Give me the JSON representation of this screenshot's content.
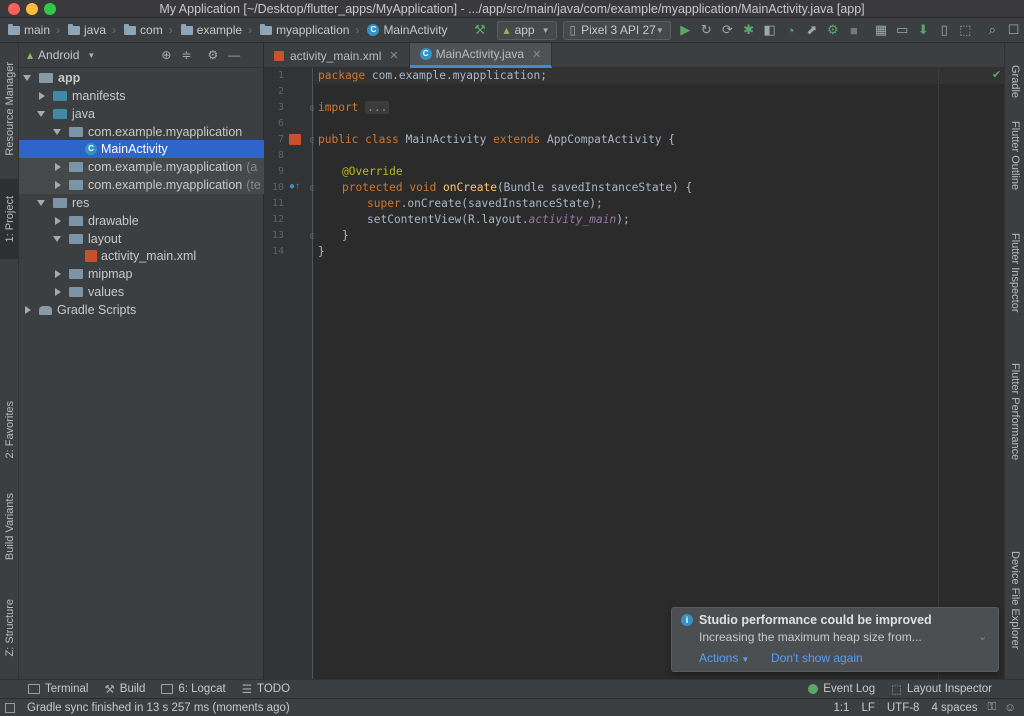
{
  "window": {
    "title": "My Application [~/Desktop/flutter_apps/MyApplication] - .../app/src/main/java/com/example/myapplication/MainActivity.java [app]"
  },
  "navbar": {
    "breadcrumbs": [
      "main",
      "java",
      "com",
      "example",
      "myapplication",
      "MainActivity"
    ],
    "run_config": "app",
    "device": "Pixel 3 API 27"
  },
  "project_panel": {
    "view_mode": "Android",
    "tree": [
      {
        "label": "app"
      },
      {
        "label": "manifests"
      },
      {
        "label": "java"
      },
      {
        "label": "com.example.myapplication"
      },
      {
        "label": "MainActivity"
      },
      {
        "label": "com.example.myapplication",
        "suffix": "(a"
      },
      {
        "label": "com.example.myapplication",
        "suffix": "(te"
      },
      {
        "label": "res"
      },
      {
        "label": "drawable"
      },
      {
        "label": "layout"
      },
      {
        "label": "activity_main.xml"
      },
      {
        "label": "mipmap"
      },
      {
        "label": "values"
      },
      {
        "label": "Gradle Scripts"
      }
    ]
  },
  "left_tool_windows": [
    "Resource Manager",
    "1: Project",
    "2: Favorites",
    "Build Variants",
    "Z: Structure"
  ],
  "right_tool_windows": [
    "Gradle",
    "Flutter Outline",
    "Flutter Inspector",
    "Flutter Performance",
    "Device File Explorer"
  ],
  "editor": {
    "tabs": [
      {
        "label": "activity_main.xml",
        "active": false
      },
      {
        "label": "MainActivity.java",
        "active": true
      }
    ],
    "line_numbers": [
      "1",
      "2",
      "3",
      "6",
      "7",
      "8",
      "9",
      "10",
      "11",
      "12",
      "13",
      "14"
    ],
    "code": {
      "l1_kw": "package",
      "l1_rest": " com.example.myapplication;",
      "l3_kw": "import",
      "l3_fold": "...",
      "l7_public": "public",
      "l7_class": " class",
      "l7_name": " MainActivity",
      "l7_extends": " extends",
      "l7_rest": " AppCompatActivity {",
      "l9_ann": "@Override",
      "l10_protected": "protected",
      "l10_void": " void",
      "l10_fn": " onCreate",
      "l10_rest": "(Bundle savedInstanceState) {",
      "l11_super": "super",
      "l11_rest": ".onCreate(savedInstanceState);",
      "l12_a": "setContentView(R.layout.",
      "l12_field": "activity_main",
      "l12_b": ");",
      "l13": "}",
      "l14": "}"
    }
  },
  "bottom_tools": {
    "terminal": "Terminal",
    "build": "Build",
    "logcat": "6: Logcat",
    "todo": "TODO",
    "event_log": "Event Log",
    "layout_inspector": "Layout Inspector"
  },
  "status": {
    "message": "Gradle sync finished in 13 s 257 ms (moments ago)",
    "position": "1:1",
    "line_sep": "LF",
    "encoding": "UTF-8",
    "indent": "4 spaces"
  },
  "notification": {
    "title": "Studio performance could be improved",
    "body": "Increasing the maximum heap size from...",
    "action_1": "Actions",
    "action_2": "Don't show again"
  },
  "colors": {
    "accent": "#4a88c7",
    "selection": "#2f65ca",
    "link": "#589df6"
  }
}
